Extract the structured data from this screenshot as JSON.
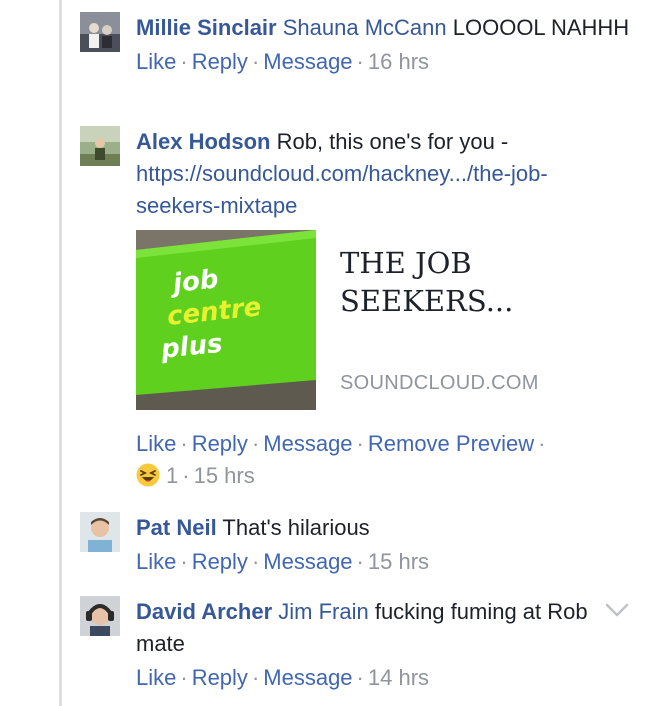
{
  "comments": [
    {
      "author": "Millie Sinclair",
      "mention": "Shauna McCann",
      "text": "LOOOOL NAHHH",
      "actions": {
        "like": "Like",
        "reply": "Reply",
        "message": "Message"
      },
      "time": "16 hrs"
    },
    {
      "author": "Alex Hodson",
      "text": "Rob, this one's for you -",
      "link": "https://soundcloud.com/hackney.../the-job-seekers-mixtape",
      "preview": {
        "sign_lines": [
          "job",
          "centre",
          "plus"
        ],
        "title": "THE JOB SEEKERS...",
        "domain": "SOUNDCLOUD.COM"
      },
      "actions": {
        "like": "Like",
        "reply": "Reply",
        "message": "Message",
        "remove_preview": "Remove Preview"
      },
      "reaction_count": "1",
      "time": "15 hrs"
    },
    {
      "author": "Pat Neil",
      "text": "That's hilarious",
      "actions": {
        "like": "Like",
        "reply": "Reply",
        "message": "Message"
      },
      "time": "15 hrs"
    },
    {
      "author": "David Archer",
      "mention": "Jim Frain",
      "text": "fucking fuming at Rob mate",
      "actions": {
        "like": "Like",
        "reply": "Reply",
        "message": "Message"
      },
      "time": "14 hrs"
    }
  ],
  "separator": "·",
  "colors": {
    "link": "#365899",
    "action": "#4267b2",
    "meta": "#90949c",
    "rail": "#dddfe2"
  },
  "icons": {
    "reaction": "laughing-emoji-icon",
    "menu": "chevron-down-icon"
  }
}
